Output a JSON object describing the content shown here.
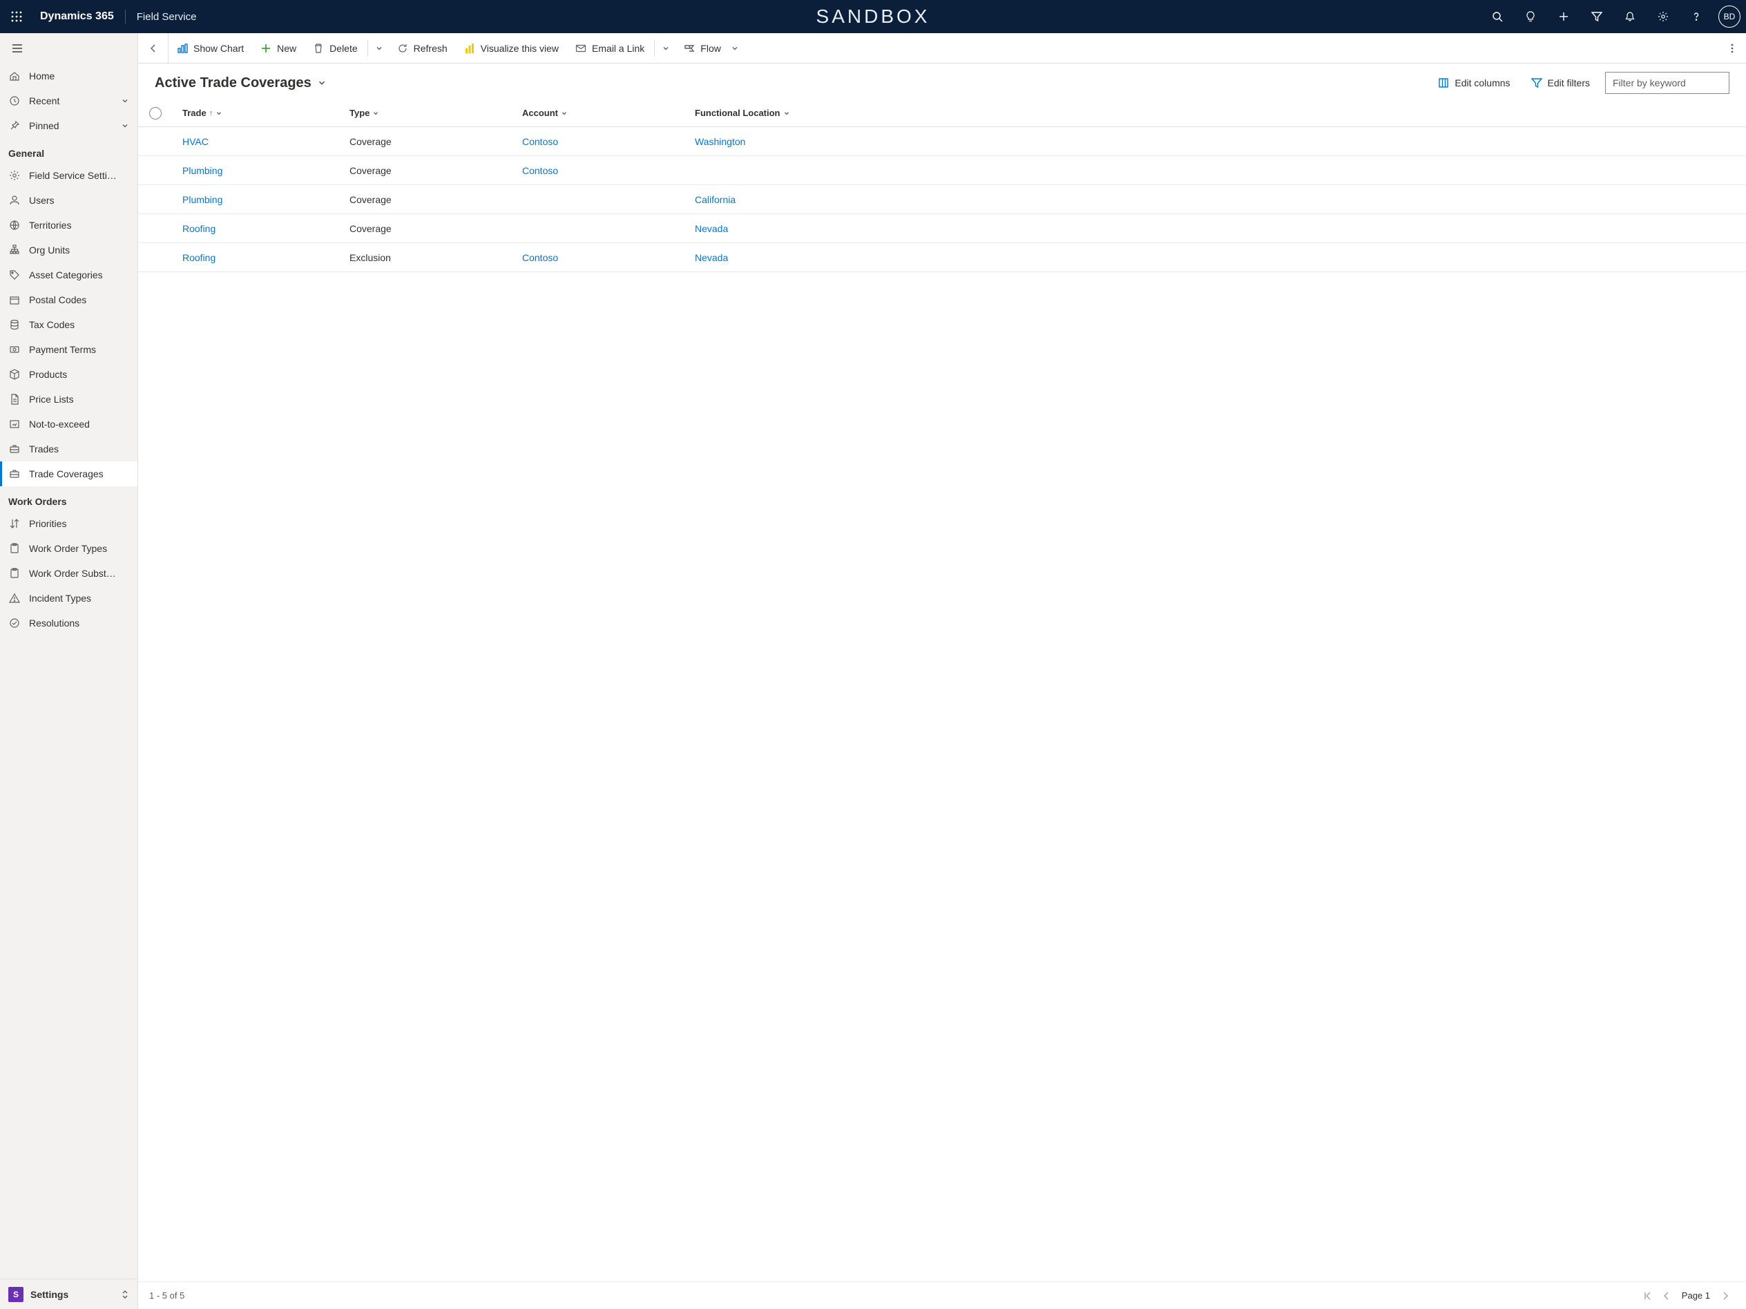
{
  "topnav": {
    "brand": "Dynamics 365",
    "appname": "Field Service",
    "environment": "SANDBOX",
    "avatar_initials": "BD"
  },
  "sidebar": {
    "top_items": [
      {
        "label": "Home"
      },
      {
        "label": "Recent",
        "has_chevron": true
      },
      {
        "label": "Pinned",
        "has_chevron": true
      }
    ],
    "sections": [
      {
        "title": "General",
        "items": [
          {
            "label": "Field Service Setti…"
          },
          {
            "label": "Users"
          },
          {
            "label": "Territories"
          },
          {
            "label": "Org Units"
          },
          {
            "label": "Asset Categories"
          },
          {
            "label": "Postal Codes"
          },
          {
            "label": "Tax Codes"
          },
          {
            "label": "Payment Terms"
          },
          {
            "label": "Products"
          },
          {
            "label": "Price Lists"
          },
          {
            "label": "Not-to-exceed"
          },
          {
            "label": "Trades"
          },
          {
            "label": "Trade Coverages",
            "active": true
          }
        ]
      },
      {
        "title": "Work Orders",
        "items": [
          {
            "label": "Priorities"
          },
          {
            "label": "Work Order Types"
          },
          {
            "label": "Work Order Subst…"
          },
          {
            "label": "Incident Types"
          },
          {
            "label": "Resolutions"
          }
        ]
      }
    ],
    "area": {
      "badge": "S",
      "label": "Settings"
    }
  },
  "commandbar": {
    "show_chart": "Show Chart",
    "new": "New",
    "delete": "Delete",
    "refresh": "Refresh",
    "visualize": "Visualize this view",
    "email_link": "Email a Link",
    "flow": "Flow"
  },
  "view": {
    "title": "Active Trade Coverages",
    "edit_columns": "Edit columns",
    "edit_filters": "Edit filters",
    "filter_placeholder": "Filter by keyword"
  },
  "grid": {
    "columns": {
      "trade": "Trade",
      "type": "Type",
      "account": "Account",
      "functional_location": "Functional Location"
    },
    "rows": [
      {
        "trade": "HVAC",
        "type": "Coverage",
        "account": "Contoso",
        "floc": "Washington"
      },
      {
        "trade": "Plumbing",
        "type": "Coverage",
        "account": "Contoso",
        "floc": ""
      },
      {
        "trade": "Plumbing",
        "type": "Coverage",
        "account": "",
        "floc": "California"
      },
      {
        "trade": "Roofing",
        "type": "Coverage",
        "account": "",
        "floc": "Nevada"
      },
      {
        "trade": "Roofing",
        "type": "Exclusion",
        "account": "Contoso",
        "floc": "Nevada"
      }
    ],
    "footer": {
      "range": "1 - 5 of 5",
      "page": "Page 1"
    }
  }
}
